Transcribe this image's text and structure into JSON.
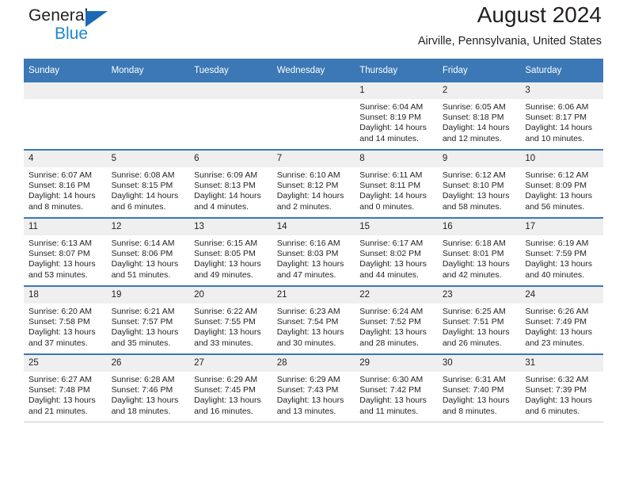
{
  "brand": {
    "name_part1": "General",
    "name_part2": "Blue",
    "triangle_color": "#1b69b4",
    "blue_color": "#1b87d2"
  },
  "header": {
    "month_title": "August 2024",
    "location": "Airville, Pennsylvania, United States",
    "header_bg": "#3b78b5",
    "daynum_bg": "#efefef"
  },
  "weekday_headers": [
    "Sunday",
    "Monday",
    "Tuesday",
    "Wednesday",
    "Thursday",
    "Friday",
    "Saturday"
  ],
  "labels": {
    "sunrise_prefix": "Sunrise:",
    "sunset_prefix": "Sunset:",
    "daylight_prefix": "Daylight:"
  },
  "weeks": [
    [
      {
        "day": "",
        "empty": true
      },
      {
        "day": "",
        "empty": true
      },
      {
        "day": "",
        "empty": true
      },
      {
        "day": "",
        "empty": true
      },
      {
        "day": "1",
        "sunrise": "Sunrise: 6:04 AM",
        "sunset": "Sunset: 8:19 PM",
        "daylight_line1": "Daylight: 14 hours",
        "daylight_line2": "and 14 minutes."
      },
      {
        "day": "2",
        "sunrise": "Sunrise: 6:05 AM",
        "sunset": "Sunset: 8:18 PM",
        "daylight_line1": "Daylight: 14 hours",
        "daylight_line2": "and 12 minutes."
      },
      {
        "day": "3",
        "sunrise": "Sunrise: 6:06 AM",
        "sunset": "Sunset: 8:17 PM",
        "daylight_line1": "Daylight: 14 hours",
        "daylight_line2": "and 10 minutes."
      }
    ],
    [
      {
        "day": "4",
        "sunrise": "Sunrise: 6:07 AM",
        "sunset": "Sunset: 8:16 PM",
        "daylight_line1": "Daylight: 14 hours",
        "daylight_line2": "and 8 minutes."
      },
      {
        "day": "5",
        "sunrise": "Sunrise: 6:08 AM",
        "sunset": "Sunset: 8:15 PM",
        "daylight_line1": "Daylight: 14 hours",
        "daylight_line2": "and 6 minutes."
      },
      {
        "day": "6",
        "sunrise": "Sunrise: 6:09 AM",
        "sunset": "Sunset: 8:13 PM",
        "daylight_line1": "Daylight: 14 hours",
        "daylight_line2": "and 4 minutes."
      },
      {
        "day": "7",
        "sunrise": "Sunrise: 6:10 AM",
        "sunset": "Sunset: 8:12 PM",
        "daylight_line1": "Daylight: 14 hours",
        "daylight_line2": "and 2 minutes."
      },
      {
        "day": "8",
        "sunrise": "Sunrise: 6:11 AM",
        "sunset": "Sunset: 8:11 PM",
        "daylight_line1": "Daylight: 14 hours",
        "daylight_line2": "and 0 minutes."
      },
      {
        "day": "9",
        "sunrise": "Sunrise: 6:12 AM",
        "sunset": "Sunset: 8:10 PM",
        "daylight_line1": "Daylight: 13 hours",
        "daylight_line2": "and 58 minutes."
      },
      {
        "day": "10",
        "sunrise": "Sunrise: 6:12 AM",
        "sunset": "Sunset: 8:09 PM",
        "daylight_line1": "Daylight: 13 hours",
        "daylight_line2": "and 56 minutes."
      }
    ],
    [
      {
        "day": "11",
        "sunrise": "Sunrise: 6:13 AM",
        "sunset": "Sunset: 8:07 PM",
        "daylight_line1": "Daylight: 13 hours",
        "daylight_line2": "and 53 minutes."
      },
      {
        "day": "12",
        "sunrise": "Sunrise: 6:14 AM",
        "sunset": "Sunset: 8:06 PM",
        "daylight_line1": "Daylight: 13 hours",
        "daylight_line2": "and 51 minutes."
      },
      {
        "day": "13",
        "sunrise": "Sunrise: 6:15 AM",
        "sunset": "Sunset: 8:05 PM",
        "daylight_line1": "Daylight: 13 hours",
        "daylight_line2": "and 49 minutes."
      },
      {
        "day": "14",
        "sunrise": "Sunrise: 6:16 AM",
        "sunset": "Sunset: 8:03 PM",
        "daylight_line1": "Daylight: 13 hours",
        "daylight_line2": "and 47 minutes."
      },
      {
        "day": "15",
        "sunrise": "Sunrise: 6:17 AM",
        "sunset": "Sunset: 8:02 PM",
        "daylight_line1": "Daylight: 13 hours",
        "daylight_line2": "and 44 minutes."
      },
      {
        "day": "16",
        "sunrise": "Sunrise: 6:18 AM",
        "sunset": "Sunset: 8:01 PM",
        "daylight_line1": "Daylight: 13 hours",
        "daylight_line2": "and 42 minutes."
      },
      {
        "day": "17",
        "sunrise": "Sunrise: 6:19 AM",
        "sunset": "Sunset: 7:59 PM",
        "daylight_line1": "Daylight: 13 hours",
        "daylight_line2": "and 40 minutes."
      }
    ],
    [
      {
        "day": "18",
        "sunrise": "Sunrise: 6:20 AM",
        "sunset": "Sunset: 7:58 PM",
        "daylight_line1": "Daylight: 13 hours",
        "daylight_line2": "and 37 minutes."
      },
      {
        "day": "19",
        "sunrise": "Sunrise: 6:21 AM",
        "sunset": "Sunset: 7:57 PM",
        "daylight_line1": "Daylight: 13 hours",
        "daylight_line2": "and 35 minutes."
      },
      {
        "day": "20",
        "sunrise": "Sunrise: 6:22 AM",
        "sunset": "Sunset: 7:55 PM",
        "daylight_line1": "Daylight: 13 hours",
        "daylight_line2": "and 33 minutes."
      },
      {
        "day": "21",
        "sunrise": "Sunrise: 6:23 AM",
        "sunset": "Sunset: 7:54 PM",
        "daylight_line1": "Daylight: 13 hours",
        "daylight_line2": "and 30 minutes."
      },
      {
        "day": "22",
        "sunrise": "Sunrise: 6:24 AM",
        "sunset": "Sunset: 7:52 PM",
        "daylight_line1": "Daylight: 13 hours",
        "daylight_line2": "and 28 minutes."
      },
      {
        "day": "23",
        "sunrise": "Sunrise: 6:25 AM",
        "sunset": "Sunset: 7:51 PM",
        "daylight_line1": "Daylight: 13 hours",
        "daylight_line2": "and 26 minutes."
      },
      {
        "day": "24",
        "sunrise": "Sunrise: 6:26 AM",
        "sunset": "Sunset: 7:49 PM",
        "daylight_line1": "Daylight: 13 hours",
        "daylight_line2": "and 23 minutes."
      }
    ],
    [
      {
        "day": "25",
        "sunrise": "Sunrise: 6:27 AM",
        "sunset": "Sunset: 7:48 PM",
        "daylight_line1": "Daylight: 13 hours",
        "daylight_line2": "and 21 minutes."
      },
      {
        "day": "26",
        "sunrise": "Sunrise: 6:28 AM",
        "sunset": "Sunset: 7:46 PM",
        "daylight_line1": "Daylight: 13 hours",
        "daylight_line2": "and 18 minutes."
      },
      {
        "day": "27",
        "sunrise": "Sunrise: 6:29 AM",
        "sunset": "Sunset: 7:45 PM",
        "daylight_line1": "Daylight: 13 hours",
        "daylight_line2": "and 16 minutes."
      },
      {
        "day": "28",
        "sunrise": "Sunrise: 6:29 AM",
        "sunset": "Sunset: 7:43 PM",
        "daylight_line1": "Daylight: 13 hours",
        "daylight_line2": "and 13 minutes."
      },
      {
        "day": "29",
        "sunrise": "Sunrise: 6:30 AM",
        "sunset": "Sunset: 7:42 PM",
        "daylight_line1": "Daylight: 13 hours",
        "daylight_line2": "and 11 minutes."
      },
      {
        "day": "30",
        "sunrise": "Sunrise: 6:31 AM",
        "sunset": "Sunset: 7:40 PM",
        "daylight_line1": "Daylight: 13 hours",
        "daylight_line2": "and 8 minutes."
      },
      {
        "day": "31",
        "sunrise": "Sunrise: 6:32 AM",
        "sunset": "Sunset: 7:39 PM",
        "daylight_line1": "Daylight: 13 hours",
        "daylight_line2": "and 6 minutes."
      }
    ]
  ]
}
